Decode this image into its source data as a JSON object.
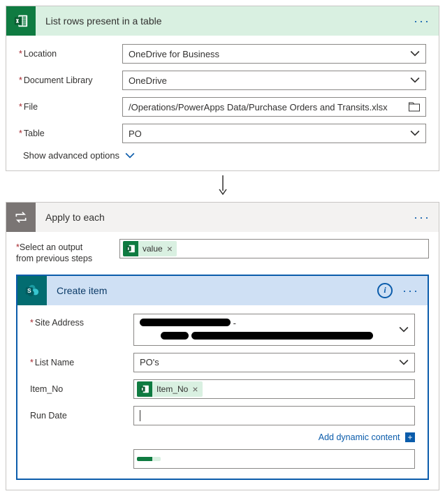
{
  "excel": {
    "title": "List rows present in a table",
    "location_label": "Location",
    "location_value": "OneDrive for Business",
    "doclib_label": "Document Library",
    "doclib_value": "OneDrive",
    "file_label": "File",
    "file_value": "/Operations/PowerApps Data/Purchase Orders and Transits.xlsx",
    "table_label": "Table",
    "table_value": "PO",
    "advanced": "Show advanced options"
  },
  "loop": {
    "title": "Apply to each",
    "select_label_1": "Select an output",
    "select_label_2": "from previous steps",
    "token_value": "value"
  },
  "sp": {
    "title": "Create item",
    "site_label": "Site Address",
    "site_sep": " - ",
    "list_label": "List Name",
    "list_value": "PO's",
    "itemno_label": "Item_No",
    "itemno_token": "Item_No",
    "rundate_label": "Run Date",
    "dyn_label": "Add dynamic content"
  }
}
